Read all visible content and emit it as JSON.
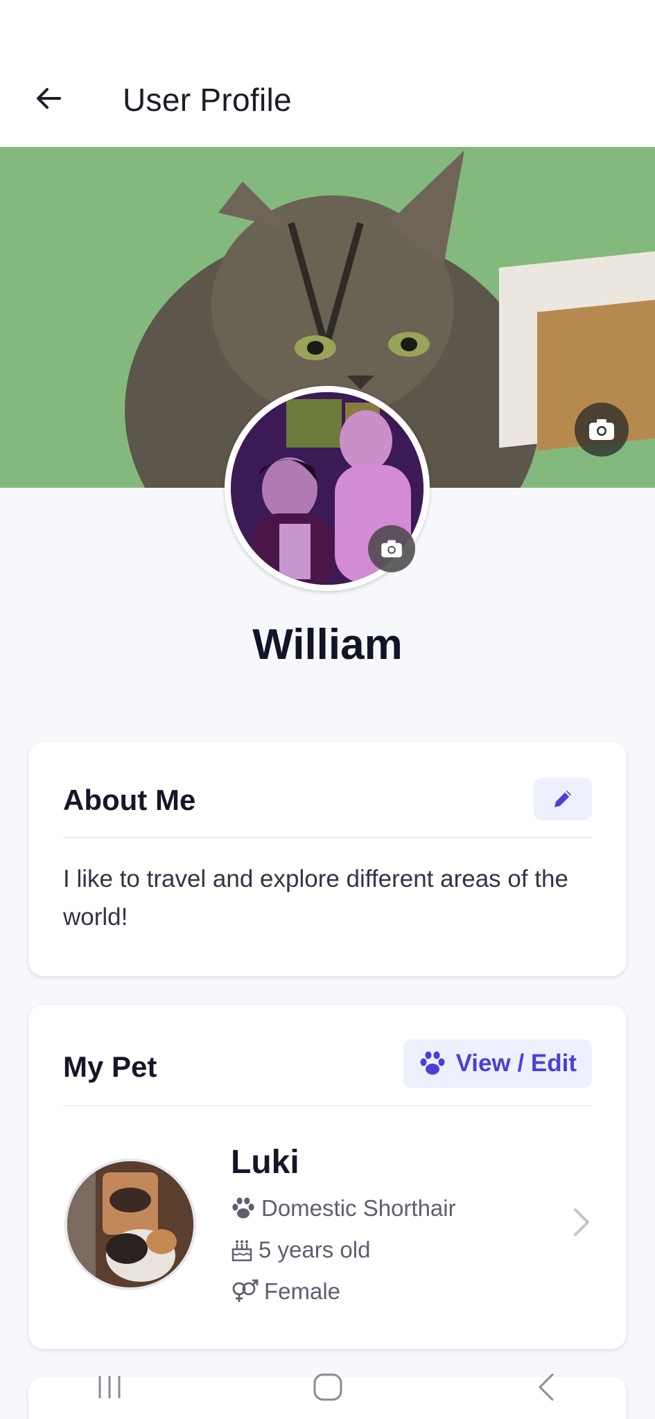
{
  "header": {
    "title": "User Profile",
    "back_icon": "arrow-left-icon"
  },
  "profile": {
    "name": "William",
    "cover_camera_icon": "camera-icon",
    "avatar_camera_icon": "camera-icon"
  },
  "about": {
    "title": "About Me",
    "text": "I like to travel and explore different areas of the world!",
    "edit_icon": "pencil-icon"
  },
  "pet": {
    "title": "My Pet",
    "view_edit_label": "View / Edit",
    "name": "Luki",
    "breed": "Domestic Shorthair",
    "age": "5 years old",
    "gender": "Female",
    "breed_icon": "paw-icon",
    "age_icon": "birthday-cake-icon",
    "gender_icon": "gender-icon"
  },
  "colors": {
    "accent": "#4a3fd8",
    "accent_bg": "#eef0ff",
    "page_bg": "#f7f8fb"
  },
  "nav": {
    "items": [
      "recent-apps-icon",
      "home-icon",
      "back-icon"
    ]
  }
}
